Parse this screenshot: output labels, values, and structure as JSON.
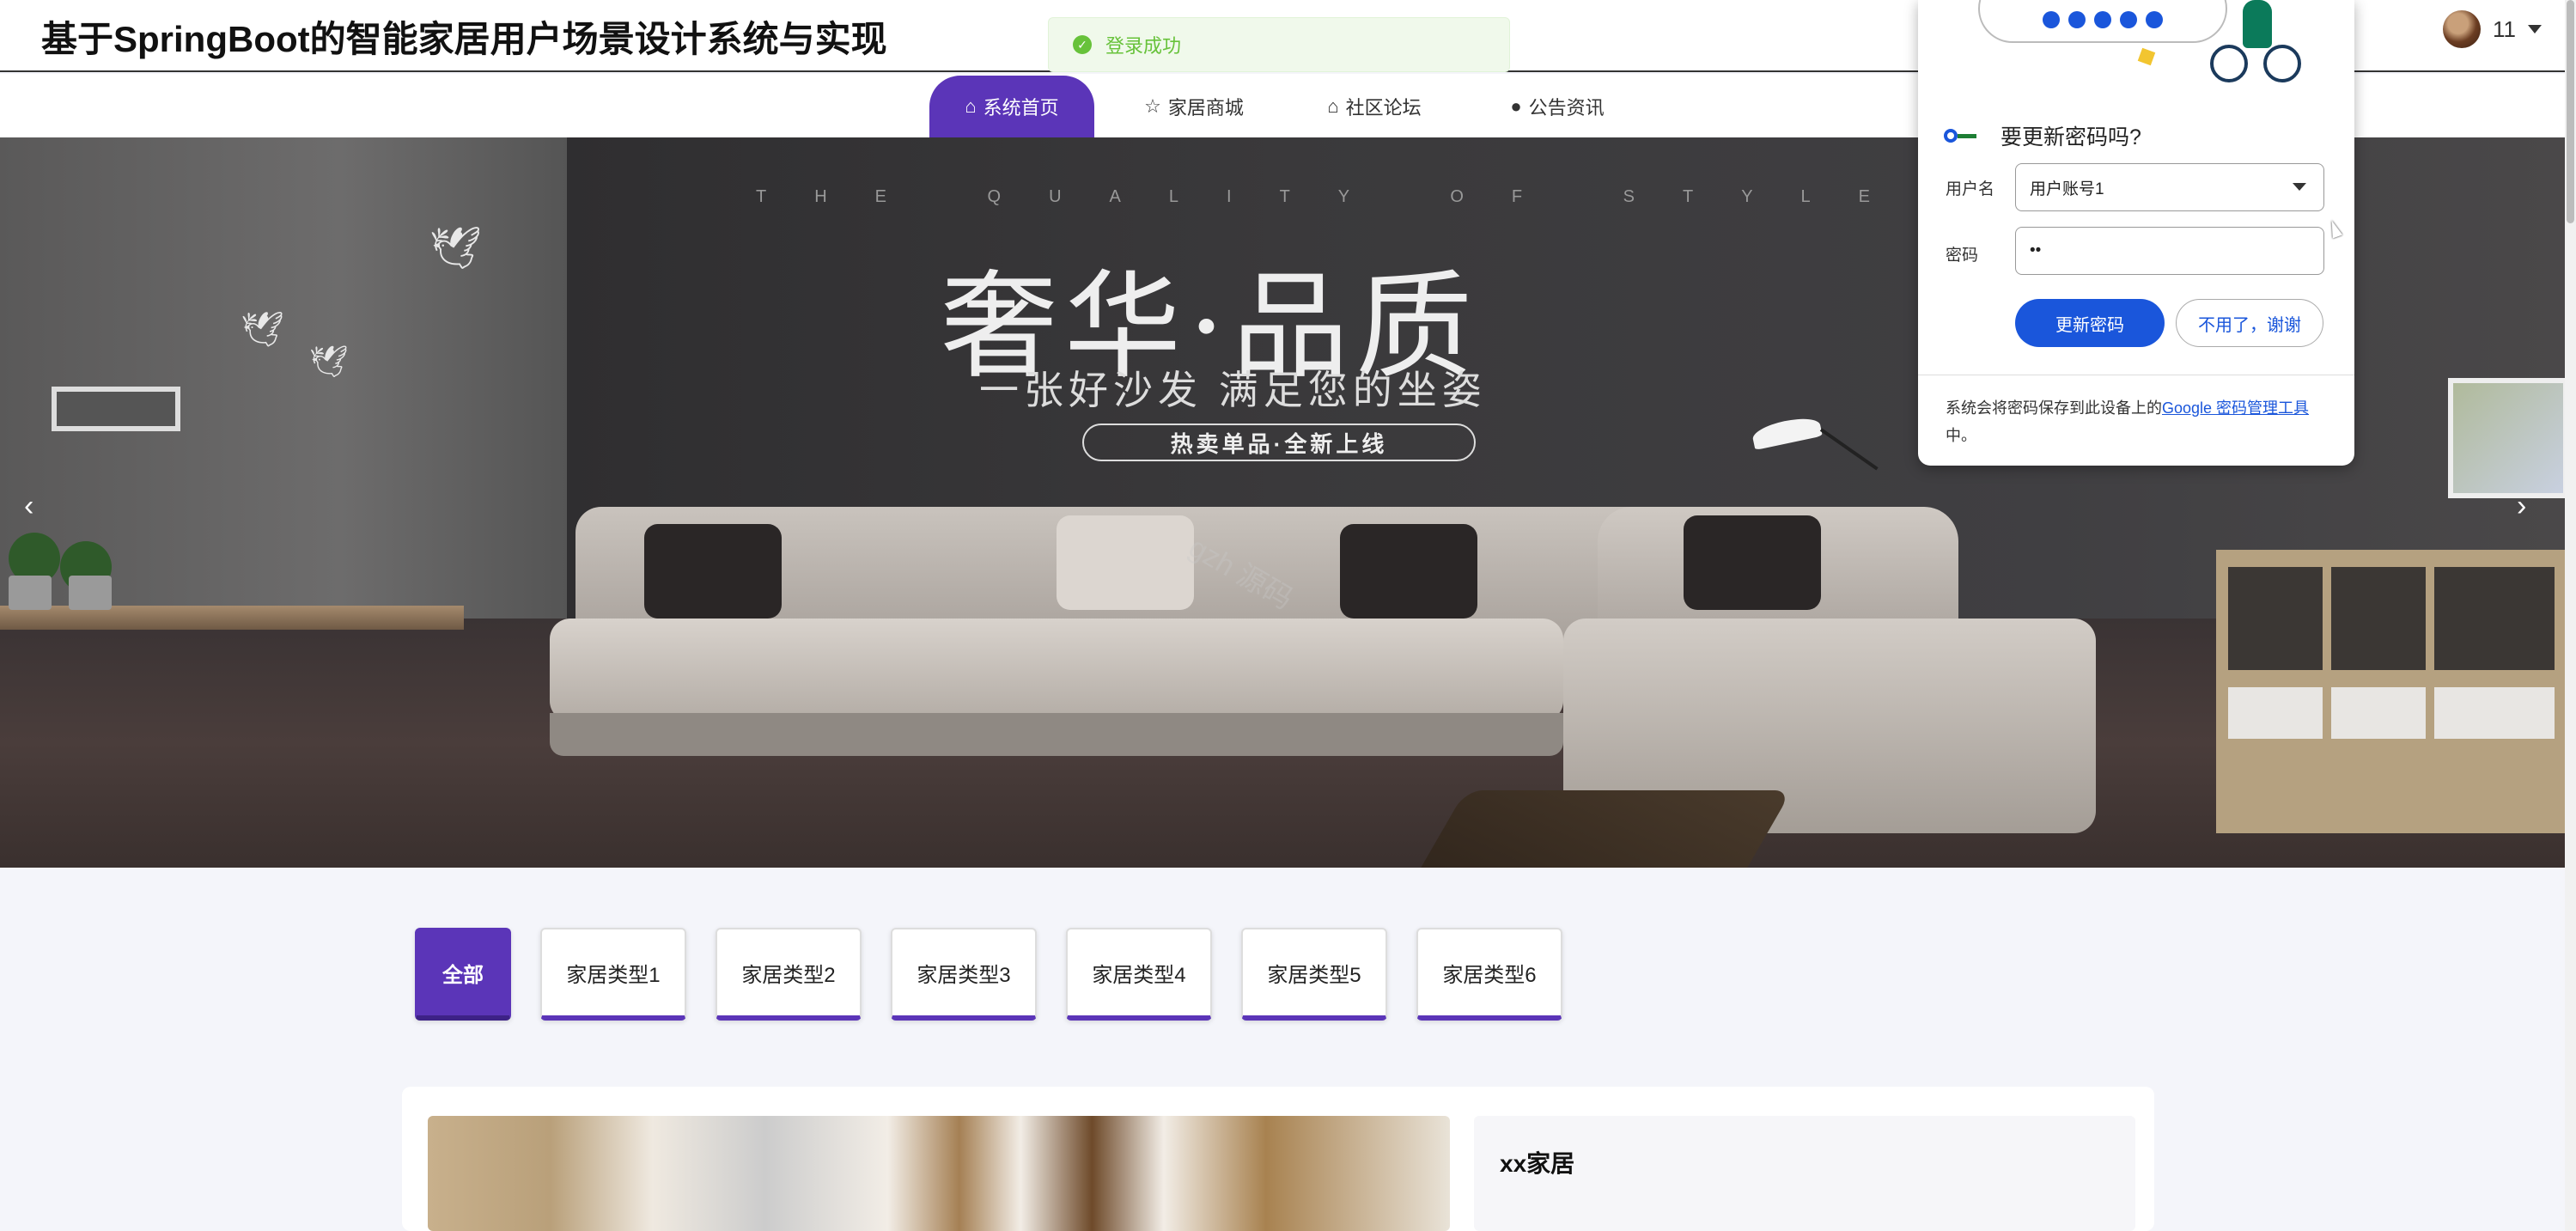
{
  "header": {
    "title": "基于SpringBoot的智能家居用户场景设计系统与实现",
    "user_name": "11"
  },
  "toast": {
    "message": "登录成功"
  },
  "nav": {
    "items": [
      {
        "label": "系统首页",
        "icon": "home-icon",
        "active": true
      },
      {
        "label": "家居商城",
        "icon": "star-icon",
        "active": false
      },
      {
        "label": "社区论坛",
        "icon": "bag-icon",
        "active": false
      },
      {
        "label": "公告资讯",
        "icon": "info-icon",
        "active": false
      }
    ]
  },
  "banner": {
    "tagline_top": "THE QUALITY OF STYLE",
    "headline": "奢华·品质",
    "subline": "一张好沙发 满足您的坐姿",
    "pill": "热卖单品·全新上线",
    "prev_arrow": "‹",
    "next_arrow": "›"
  },
  "categories": [
    {
      "label": "全部",
      "active": true
    },
    {
      "label": "家居类型1",
      "active": false
    },
    {
      "label": "家居类型2",
      "active": false
    },
    {
      "label": "家居类型3",
      "active": false
    },
    {
      "label": "家居类型4",
      "active": false
    },
    {
      "label": "家居类型5",
      "active": false
    },
    {
      "label": "家居类型6",
      "active": false
    }
  ],
  "card": {
    "title": "xx家居"
  },
  "password_popup": {
    "title": "要更新密码吗?",
    "username_label": "用户名",
    "username_value": "用户账号1",
    "password_label": "密码",
    "password_value": "••",
    "update_button": "更新密码",
    "decline_button": "不用了，谢谢",
    "footer_text": "系统会将密码保存到此设备上的",
    "footer_link": "Google 密码管理工具",
    "footer_suffix": "中。"
  },
  "colors": {
    "accent": "#5b35b8",
    "google_blue": "#1a56db",
    "success": "#67c23a"
  }
}
